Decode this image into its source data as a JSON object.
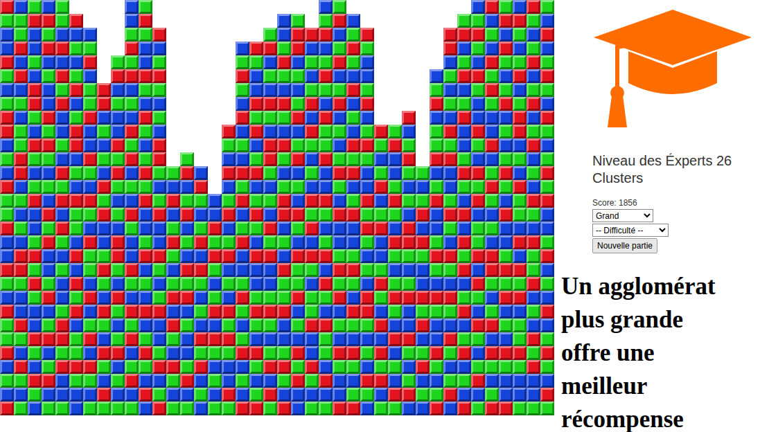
{
  "board": {
    "palette": {
      "r": "#e3141f",
      "g": "#1fd61f",
      "b": "#1544dc"
    },
    "columns": [
      {
        "tiles": "rgbbrgbgrrbgbrggrbbrgbrggrbgbr"
      },
      {
        "tiles": "bggrbrbgbggrrbgbgbrrgbbrgbrgbg"
      },
      {
        "tiles": "grbbgbrrgbrgbgrbbgrgrgbbrgbrgb"
      },
      {
        "tiles": "brgrbgbbrgrgbgbrgrbbgrbgrbgrbg"
      },
      {
        "tiles": "ggbrbrgrbbgbrgrbrgbgbbgrrgrbbg"
      },
      {
        "tiles": "rbgbgrbgrrbgbrggbrbrgrbggrgbb"
      },
      {
        "tiles": "bgrbggrbbrgbrgbrggbrbgrbrgbg"
      },
      {
        "tiles": "rrbgbgbrgrbbgrgbrgbrgbrg"
      },
      {
        "tiles": "grbgbbrgrgbgbrrgbrgbgrbgbg"
      },
      {
        "tiles": "bbgrgrbgbrgrbgbrgbbrgbrgrbgrbg"
      },
      {
        "tiles": "grgbbrgbrgbgrgrbbgrbgbrbgrgbrb"
      },
      {
        "tiles": "rbgrgbgbrrgbgrbbrgbgrbbgrbgr"
      },
      {
        "tiles": "gbrbgrgbgrbrgbrgbg"
      },
      {
        "tiles": "grbgrbgbrgrbgbbgrbg"
      },
      {
        "tiles": "brgbgrbrgbgbrgrbgb"
      },
      {
        "tiles": "bbrgrgbgrbrgbgbg"
      },
      {
        "tiles": "rgbrbgrbgrbgbrgrgbbrg"
      },
      {
        "tiles": "bgrgbrbgbrgrbgrbbgrgbgrbgbr"
      },
      {
        "tiles": "rgbbrgrbgrbgrgbrbbgrgbrgbgr"
      },
      {
        "tiles": "grbgbrgbrrgbgbrgrbbgrgbgrbrg"
      },
      {
        "tiles": "bbgrgbrgbrgbgrrbgbrggrbbgrgbr"
      },
      {
        "tiles": "grrbgbgrbgrbgbrgbrggrbgbrgrbb"
      },
      {
        "tiles": "rbgbgrbrgbgbrgrbrgbggrbbrgbg"
      },
      {
        "tiles": "bgrbgrgbrggrbbrgbgrbrgbrggbrbg"
      },
      {
        "tiles": "grbgrbgrbgbgrgbrbbgrgrbgbrgbbr"
      },
      {
        "tiles": "bgrgbrbgbrgrbgrbbgrgbrgbrgbgr"
      },
      {
        "tiles": "rgbbgrbgrgbbrgrgbgbrrgbgbrgb"
      },
      {
        "tiles": "rgbgrbgrbbgrgbrbrgrbg"
      },
      {
        "tiles": "grbbgrgbrgbgrgbrbgbrg"
      },
      {
        "tiles": "rbgrgbgbrrgbgrbbrgbgrb"
      },
      {
        "tiles": "gbgrbrgbbrgrbgrbgb"
      },
      {
        "tiles": "bgrbggrbgrbbgrgbrgbbrgbgr"
      },
      {
        "tiles": "rrbgbgbrgrbbgrgbrgbrgbrgbgrb"
      },
      {
        "tiles": "grbgrbgrbbgrgbrbrgrbgrbgrbgbr"
      },
      {
        "tiles": "bgrgbrgbbrgbrgrbggrbrgbrgbgrbg"
      },
      {
        "tiles": "rbgbrgrgbbrbgrgbgbrrgbgrbrgbgr"
      },
      {
        "tiles": "grbrgbgrbgbgrgbrbbgrgrbgbrgbbr"
      },
      {
        "tiles": "brgbgrbgrrbgbrggbrbrgrbggrgbbg"
      },
      {
        "tiles": "rgbgrbgrbgrbgbrgbrggrbgbrgrbbg"
      },
      {
        "tiles": "gbrbgrgbrgbgrgrbbgrbgbrbgrgbrg"
      }
    ]
  },
  "panel": {
    "title": "Niveau des Éxperts 26 Clusters",
    "score": "Score: 1856",
    "size_select": {
      "value": "Grand"
    },
    "difficulty_select": {
      "value": "-- Difficulté --"
    },
    "new_game_button": "Nouvelle partie"
  },
  "caption": [
    "Un agglomérat",
    "plus grande",
    "offre une",
    "meilleur",
    "récompense"
  ]
}
